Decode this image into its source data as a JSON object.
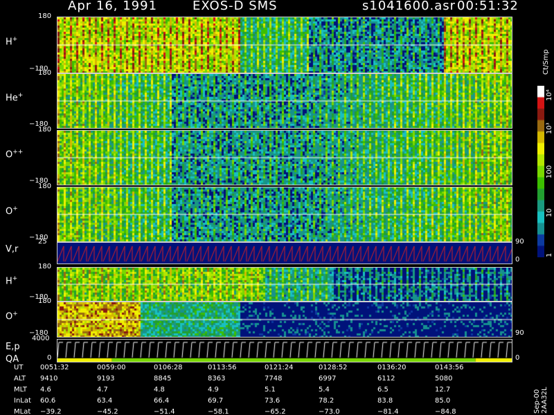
{
  "header": {
    "date": "Apr 16, 1991",
    "instrument": "EXOS-D SMS",
    "file": "s1041600.asr",
    "time": "00:51:32"
  },
  "colorbar": {
    "unit": "Ct/Smp",
    "ticks": [
      "10⁴",
      "10³",
      "100",
      "10",
      "1"
    ],
    "colors": [
      "#ffffff",
      "#d41414",
      "#8a1a10",
      "#9a6a10",
      "#d4b800",
      "#f0f000",
      "#b4e600",
      "#7ad800",
      "#3cbf00",
      "#22a030",
      "#1a9a80",
      "#18c0c0",
      "#169090",
      "#0c3aa0",
      "#00127a"
    ]
  },
  "side_text": "Sep-00  2AA32L",
  "panels": [
    {
      "label": "H",
      "sup": "+",
      "ymax": "180",
      "ymin": "−180"
    },
    {
      "label": "He",
      "sup": "+",
      "ymax": "180",
      "ymin": "−180"
    },
    {
      "label": "O",
      "sup": "++",
      "ymax": "180",
      "ymin": "−180"
    },
    {
      "label": "O",
      "sup": "+",
      "ymax": "180",
      "ymin": "−180"
    },
    {
      "label": "V,r",
      "sup": "",
      "ymax": "25",
      "ymin": "",
      "right_top": "90",
      "right_bottom": "0"
    },
    {
      "label": "H",
      "sup": "+",
      "ymax": "180",
      "ymin": "−180"
    },
    {
      "label": "O",
      "sup": "+",
      "ymax": "180",
      "ymin": "−180",
      "right_bottom": "90"
    },
    {
      "label": "E,p",
      "sup": "",
      "label2": "QA",
      "ymax": "4000",
      "ymin": "0",
      "right_bottom": "0"
    }
  ],
  "table": {
    "headers": [
      "UT",
      "ALT",
      "MLT",
      "InLat",
      "MLat"
    ],
    "columns": [
      [
        "0051:32",
        "9410",
        "4.6",
        "60.6",
        "−39.2"
      ],
      [
        "0059:00",
        "9193",
        "4.7",
        "63.4",
        "−45.2"
      ],
      [
        "0106:28",
        "8845",
        "4.8",
        "66.4",
        "−51.4"
      ],
      [
        "0113:56",
        "8363",
        "4.9",
        "69.7",
        "−58.1"
      ],
      [
        "0121:24",
        "7748",
        "5.1",
        "73.6",
        "−65.2"
      ],
      [
        "0128:52",
        "6997",
        "5.4",
        "78.2",
        "−73.0"
      ],
      [
        "0136:20",
        "6112",
        "6.5",
        "83.8",
        "−81.4"
      ],
      [
        "0143:56",
        "5080",
        "12.7",
        "85.0",
        "−84.8"
      ]
    ]
  },
  "chart_data": {
    "type": "heatmap",
    "title": "Apr 16, 1991   EXOS-D SMS",
    "x_ticks": [
      "0051:32",
      "0059:00",
      "0106:28",
      "0113:56",
      "0121:24",
      "0128:52",
      "0136:20",
      "0143:56"
    ],
    "series": [
      {
        "name": "H+",
        "ylim": [
          -180,
          180
        ]
      },
      {
        "name": "He+",
        "ylim": [
          -180,
          180
        ]
      },
      {
        "name": "O++",
        "ylim": [
          -180,
          180
        ]
      },
      {
        "name": "O+",
        "ylim": [
          -180,
          180
        ]
      },
      {
        "name": "V,r",
        "ylim": [
          0,
          25
        ]
      },
      {
        "name": "H+",
        "ylim": [
          -180,
          180
        ]
      },
      {
        "name": "O+",
        "ylim": [
          -180,
          180
        ]
      },
      {
        "name": "E,p",
        "ylim": [
          0,
          4000
        ]
      }
    ],
    "colorbar_unit": "Ct/Smp",
    "colorbar_range": [
      1,
      10000
    ],
    "colorbar_scale": "log"
  }
}
